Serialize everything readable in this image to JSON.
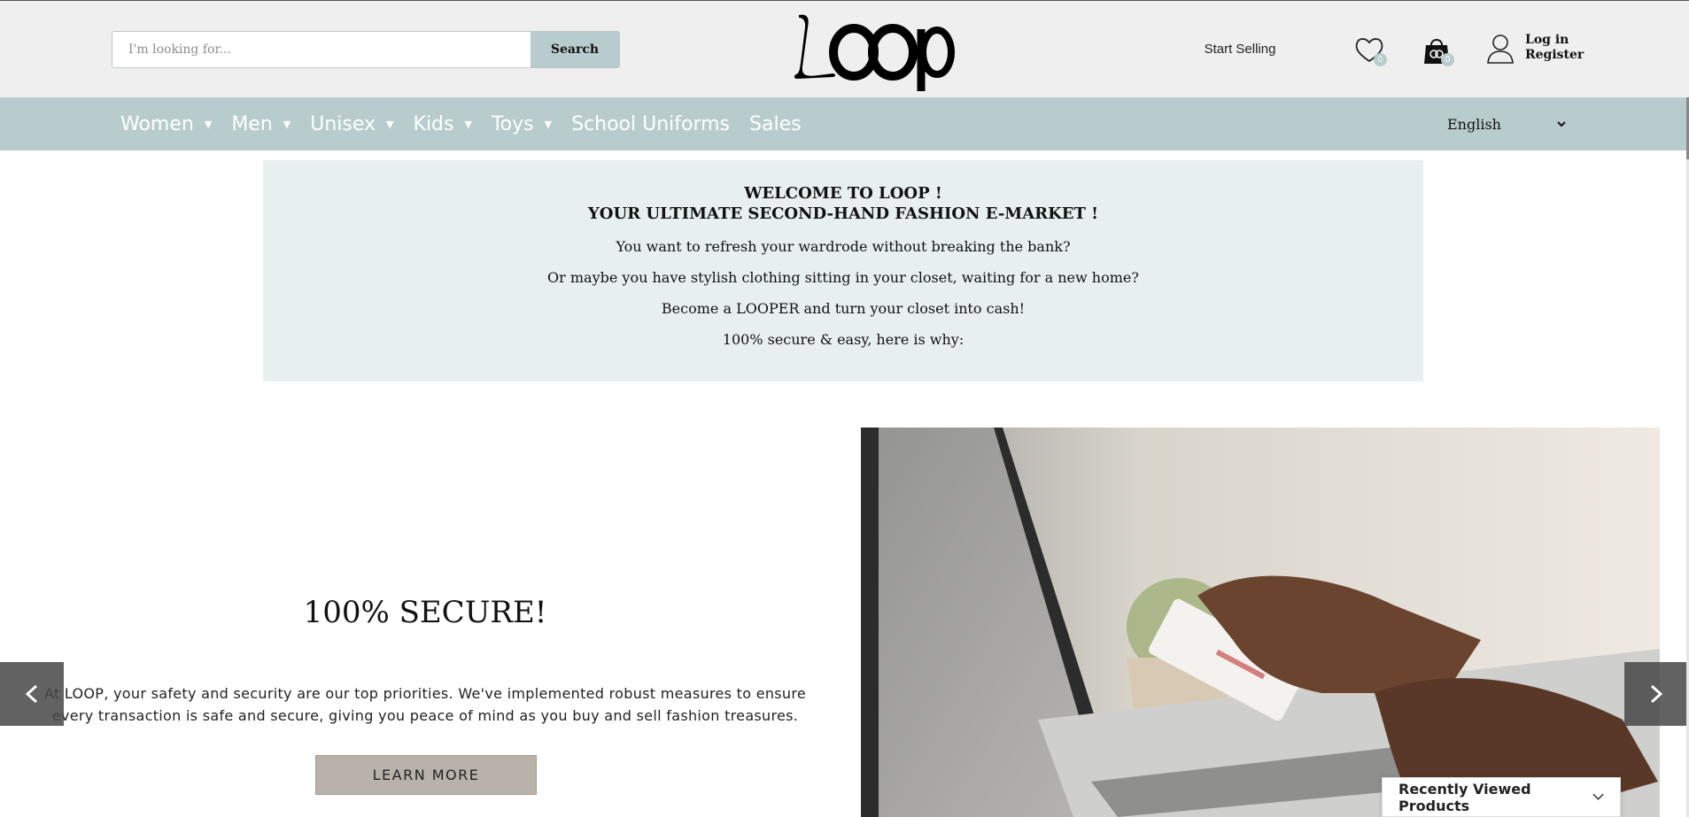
{
  "header": {
    "search": {
      "placeholder": "I'm looking for...",
      "button_label": "Search"
    },
    "brand": "Loop",
    "start_selling": "Start Selling",
    "wishlist_count": "0",
    "cart_count": "0",
    "login": "Log in",
    "register": "Register"
  },
  "nav": {
    "items": [
      {
        "label": "Women",
        "has_dropdown": true
      },
      {
        "label": "Men",
        "has_dropdown": true
      },
      {
        "label": "Unisex",
        "has_dropdown": true
      },
      {
        "label": "Kids",
        "has_dropdown": true
      },
      {
        "label": "Toys",
        "has_dropdown": true
      },
      {
        "label": "School Uniforms",
        "has_dropdown": false
      },
      {
        "label": "Sales",
        "has_dropdown": false
      }
    ],
    "language": "English"
  },
  "welcome": {
    "title_line1": "WELCOME TO LOOP !",
    "title_line2": "YOUR ULTIMATE SECOND-HAND FASHION E-MARKET !",
    "line1": "You want to refresh your wardrode without breaking the bank?",
    "line2": "Or maybe you have stylish clothing sitting in your closet, waiting for a new home?",
    "line3": "Become a LOOPER and turn your closet into cash!",
    "line4": "100% secure & easy, here is why:"
  },
  "hero": {
    "title": "100% SECURE!",
    "text": "At LOOP, your safety and security are our top priorities. We've implemented robust measures to ensure every transaction is safe and secure, giving you peace of mind as you buy and sell fashion treasures.",
    "button_label": "LEARN MORE"
  },
  "recently_viewed": "Recently Viewed Products",
  "colors": {
    "nav_bg": "#b8cccd",
    "welcome_bg": "#e8f0ef",
    "header_bg": "#efefef",
    "button_bg": "#b9b2aa"
  }
}
